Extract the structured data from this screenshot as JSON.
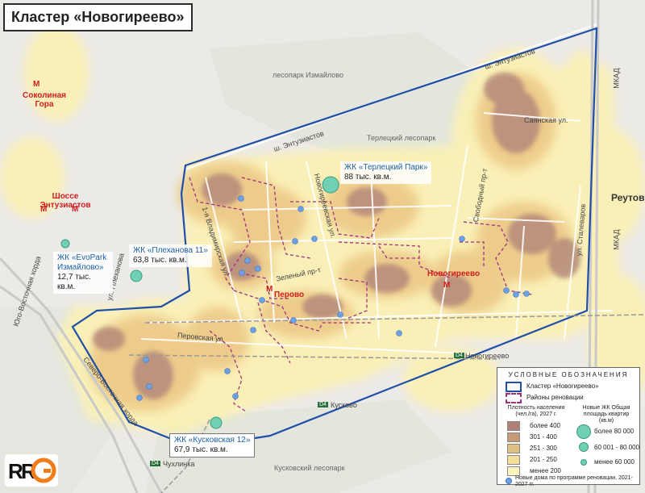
{
  "title": "Кластер «Новогиреево»",
  "streets": {
    "entuziastov_1": "ш. Энтузиастов",
    "entuziastov_2": "ш. Энтузиастов",
    "mkad_1": "МКАД",
    "mkad_2": "МКАД",
    "sayanskaya": "Саянская ул.",
    "svobodny": "Свободный пр-т",
    "novogireevskaya": "Новогиреевская ул.",
    "vladimirskaya": "1-я Владимирская ул.",
    "plekhanova": "ул. Плеханова",
    "zeleny": "Зеленый пр-т",
    "perovskaya": "Перовская ул.",
    "stalevarov": "ул. Сталеваров",
    "yuvh": "Юго-Восточная хорда",
    "svh": "Северо-Восточная хорда"
  },
  "places": {
    "izmaylovo_forest": "лесопарк Измайлово",
    "terletsky_forest": "Терлецкий лесопарк",
    "kuskovsky_forest": "Кусковский лесопарк",
    "reutov": "Реутов"
  },
  "stations": {
    "novogireevo_rail": "Новогиреево",
    "kuskovo": "Кусково",
    "chukhlinka": "Чухлинка",
    "d4_1": "D4",
    "d4_2": "D4",
    "d4_3": "D4"
  },
  "metro": {
    "sokolnaya_gora": "Соколиная Гора",
    "shosse_entuziastov": "Шоссе Энтузиастов",
    "perovo": "Перово",
    "novogireevo": "Новогиреево",
    "icon": "М"
  },
  "jk": [
    {
      "name": "ЖК «Терлецкий Парк»",
      "area": "88 тыс. кв.м."
    },
    {
      "name": "ЖК «Плеханова 11»",
      "area": "63,8 тыс. кв.м."
    },
    {
      "name": "ЖК «EvoPark Измайлово»",
      "area": "12,7 тыс. кв.м."
    },
    {
      "name": "ЖК «Кусковская 12»",
      "area": "67,9 тыс. кв.м."
    }
  ],
  "legend": {
    "title": "УСЛОВНЫЕ ОБОЗНАЧЕНИЯ",
    "cluster": "Кластер «Новогиреево»",
    "renovation": "Районы реновации",
    "density_title": "Плотность населения (чел./га), 2027 г.",
    "density_levels": [
      {
        "label": "более 400",
        "color": "#b07f78"
      },
      {
        "label": "301 - 400",
        "color": "#c69a77"
      },
      {
        "label": "251 - 300",
        "color": "#e0bf85"
      },
      {
        "label": "201 - 250",
        "color": "#f3df9a"
      },
      {
        "label": "менее 200",
        "color": "#fbf4bd"
      }
    ],
    "jk_title": "Новые ЖК Общая площадь квартир (кв.м)",
    "jk_levels": [
      "более 80 000",
      "60 001 - 80 000",
      "менее 60 000"
    ],
    "new_houses": "Новые дома по программе реновации, 2021-2027 гг."
  },
  "logo": {
    "text": "RRG",
    "color_r": "#111111",
    "color_g": "#f07d1a"
  },
  "colors": {
    "cluster_border": "#1f4fa8",
    "renovation": "#a0307d",
    "park": "#dfe8d4",
    "jk_circle": "#6fd0b4",
    "house_point": "#6fa1e2"
  }
}
